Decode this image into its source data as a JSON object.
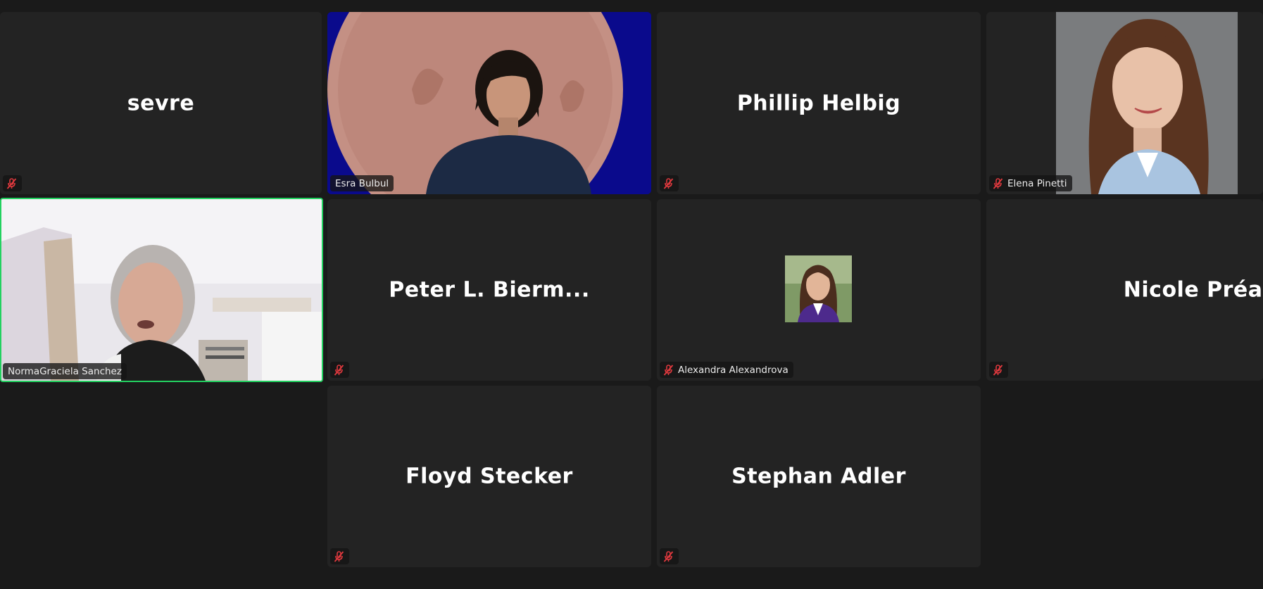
{
  "participants": [
    {
      "name": "sevre",
      "label": "",
      "muted": true,
      "video": false
    },
    {
      "name": "Esra Bulbul",
      "label": "Esra Bulbul",
      "muted": false,
      "video": true
    },
    {
      "name": "Phillip Helbig",
      "label": "",
      "muted": true,
      "video": false
    },
    {
      "name": "Elena Pinetti",
      "label": "Elena Pinetti",
      "muted": true,
      "video": true
    },
    {
      "name": "NormaGraciela Sanchez",
      "label": "NormaGraciela Sanchez",
      "muted": false,
      "video": true,
      "active_speaker": true
    },
    {
      "name": "Peter L. Bierm...",
      "label": "",
      "muted": true,
      "video": false
    },
    {
      "name": "Alexandra Alexandrova",
      "label": "Alexandra Alexandrova",
      "muted": true,
      "video": false,
      "avatar": true
    },
    {
      "name": "Nicole Préaux",
      "label": "",
      "muted": true,
      "video": false
    },
    {
      "name": "Floyd Stecker",
      "label": "",
      "muted": true,
      "video": false
    },
    {
      "name": "Stephan Adler",
      "label": "",
      "muted": true,
      "video": false
    }
  ],
  "colors": {
    "background": "#1a1a1a",
    "tile": "#232323",
    "active_border": "#23d160",
    "mute_icon": "#e0393e",
    "name_text": "#ffffff"
  },
  "icons": {
    "muted": "microphone-muted-icon"
  }
}
